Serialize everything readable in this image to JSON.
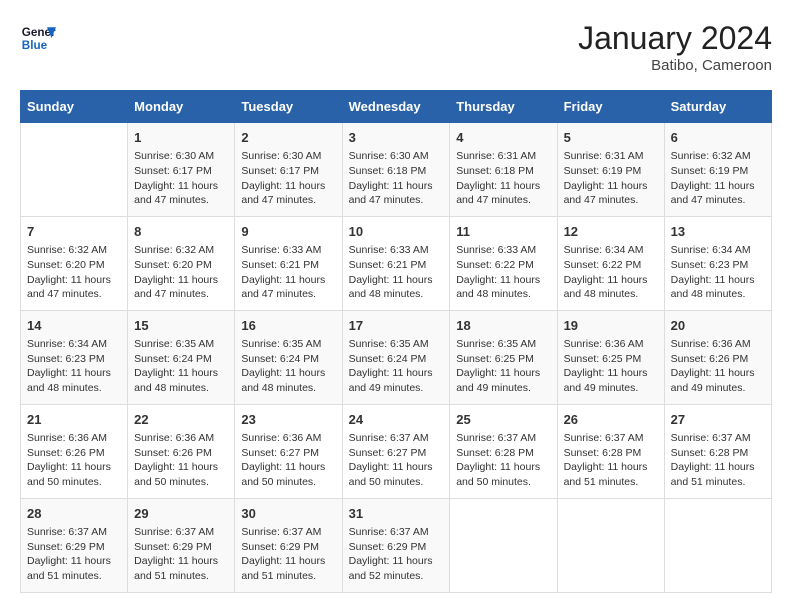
{
  "header": {
    "logo_line1": "General",
    "logo_line2": "Blue",
    "month_year": "January 2024",
    "location": "Batibo, Cameroon"
  },
  "days_of_week": [
    "Sunday",
    "Monday",
    "Tuesday",
    "Wednesday",
    "Thursday",
    "Friday",
    "Saturday"
  ],
  "weeks": [
    [
      {
        "day": "",
        "info": ""
      },
      {
        "day": "1",
        "info": "Sunrise: 6:30 AM\nSunset: 6:17 PM\nDaylight: 11 hours\nand 47 minutes."
      },
      {
        "day": "2",
        "info": "Sunrise: 6:30 AM\nSunset: 6:17 PM\nDaylight: 11 hours\nand 47 minutes."
      },
      {
        "day": "3",
        "info": "Sunrise: 6:30 AM\nSunset: 6:18 PM\nDaylight: 11 hours\nand 47 minutes."
      },
      {
        "day": "4",
        "info": "Sunrise: 6:31 AM\nSunset: 6:18 PM\nDaylight: 11 hours\nand 47 minutes."
      },
      {
        "day": "5",
        "info": "Sunrise: 6:31 AM\nSunset: 6:19 PM\nDaylight: 11 hours\nand 47 minutes."
      },
      {
        "day": "6",
        "info": "Sunrise: 6:32 AM\nSunset: 6:19 PM\nDaylight: 11 hours\nand 47 minutes."
      }
    ],
    [
      {
        "day": "7",
        "info": "Sunrise: 6:32 AM\nSunset: 6:20 PM\nDaylight: 11 hours\nand 47 minutes."
      },
      {
        "day": "8",
        "info": "Sunrise: 6:32 AM\nSunset: 6:20 PM\nDaylight: 11 hours\nand 47 minutes."
      },
      {
        "day": "9",
        "info": "Sunrise: 6:33 AM\nSunset: 6:21 PM\nDaylight: 11 hours\nand 47 minutes."
      },
      {
        "day": "10",
        "info": "Sunrise: 6:33 AM\nSunset: 6:21 PM\nDaylight: 11 hours\nand 48 minutes."
      },
      {
        "day": "11",
        "info": "Sunrise: 6:33 AM\nSunset: 6:22 PM\nDaylight: 11 hours\nand 48 minutes."
      },
      {
        "day": "12",
        "info": "Sunrise: 6:34 AM\nSunset: 6:22 PM\nDaylight: 11 hours\nand 48 minutes."
      },
      {
        "day": "13",
        "info": "Sunrise: 6:34 AM\nSunset: 6:23 PM\nDaylight: 11 hours\nand 48 minutes."
      }
    ],
    [
      {
        "day": "14",
        "info": "Sunrise: 6:34 AM\nSunset: 6:23 PM\nDaylight: 11 hours\nand 48 minutes."
      },
      {
        "day": "15",
        "info": "Sunrise: 6:35 AM\nSunset: 6:24 PM\nDaylight: 11 hours\nand 48 minutes."
      },
      {
        "day": "16",
        "info": "Sunrise: 6:35 AM\nSunset: 6:24 PM\nDaylight: 11 hours\nand 48 minutes."
      },
      {
        "day": "17",
        "info": "Sunrise: 6:35 AM\nSunset: 6:24 PM\nDaylight: 11 hours\nand 49 minutes."
      },
      {
        "day": "18",
        "info": "Sunrise: 6:35 AM\nSunset: 6:25 PM\nDaylight: 11 hours\nand 49 minutes."
      },
      {
        "day": "19",
        "info": "Sunrise: 6:36 AM\nSunset: 6:25 PM\nDaylight: 11 hours\nand 49 minutes."
      },
      {
        "day": "20",
        "info": "Sunrise: 6:36 AM\nSunset: 6:26 PM\nDaylight: 11 hours\nand 49 minutes."
      }
    ],
    [
      {
        "day": "21",
        "info": "Sunrise: 6:36 AM\nSunset: 6:26 PM\nDaylight: 11 hours\nand 50 minutes."
      },
      {
        "day": "22",
        "info": "Sunrise: 6:36 AM\nSunset: 6:26 PM\nDaylight: 11 hours\nand 50 minutes."
      },
      {
        "day": "23",
        "info": "Sunrise: 6:36 AM\nSunset: 6:27 PM\nDaylight: 11 hours\nand 50 minutes."
      },
      {
        "day": "24",
        "info": "Sunrise: 6:37 AM\nSunset: 6:27 PM\nDaylight: 11 hours\nand 50 minutes."
      },
      {
        "day": "25",
        "info": "Sunrise: 6:37 AM\nSunset: 6:28 PM\nDaylight: 11 hours\nand 50 minutes."
      },
      {
        "day": "26",
        "info": "Sunrise: 6:37 AM\nSunset: 6:28 PM\nDaylight: 11 hours\nand 51 minutes."
      },
      {
        "day": "27",
        "info": "Sunrise: 6:37 AM\nSunset: 6:28 PM\nDaylight: 11 hours\nand 51 minutes."
      }
    ],
    [
      {
        "day": "28",
        "info": "Sunrise: 6:37 AM\nSunset: 6:29 PM\nDaylight: 11 hours\nand 51 minutes."
      },
      {
        "day": "29",
        "info": "Sunrise: 6:37 AM\nSunset: 6:29 PM\nDaylight: 11 hours\nand 51 minutes."
      },
      {
        "day": "30",
        "info": "Sunrise: 6:37 AM\nSunset: 6:29 PM\nDaylight: 11 hours\nand 51 minutes."
      },
      {
        "day": "31",
        "info": "Sunrise: 6:37 AM\nSunset: 6:29 PM\nDaylight: 11 hours\nand 52 minutes."
      },
      {
        "day": "",
        "info": ""
      },
      {
        "day": "",
        "info": ""
      },
      {
        "day": "",
        "info": ""
      }
    ]
  ]
}
